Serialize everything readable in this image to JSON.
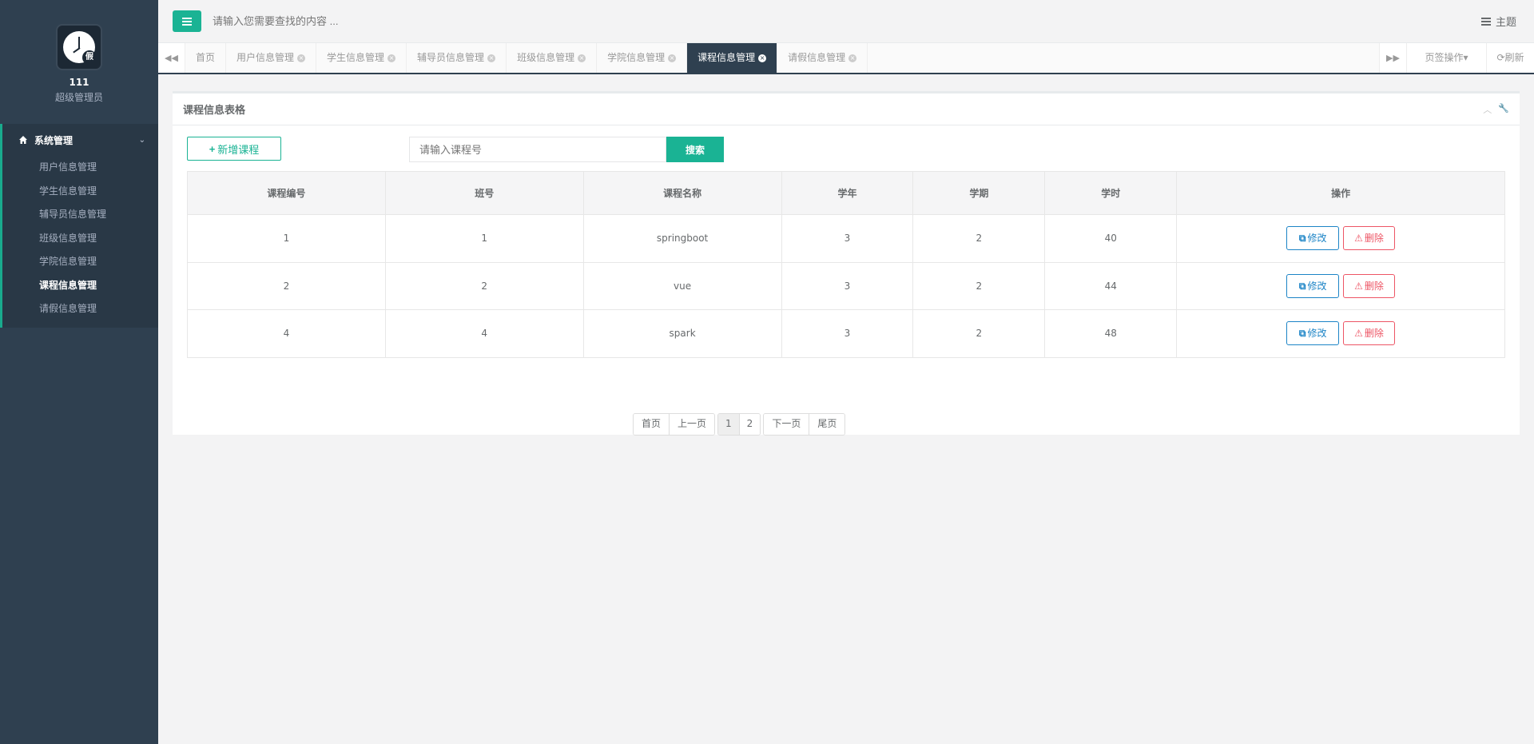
{
  "user": {
    "name": "111",
    "role": "超级管理员",
    "avatar_badge": "假"
  },
  "sidebar": {
    "group_label": "系统管理",
    "items": [
      {
        "label": "用户信息管理"
      },
      {
        "label": "学生信息管理"
      },
      {
        "label": "辅导员信息管理"
      },
      {
        "label": "班级信息管理"
      },
      {
        "label": "学院信息管理"
      },
      {
        "label": "课程信息管理",
        "active": true
      },
      {
        "label": "请假信息管理"
      }
    ]
  },
  "topbar": {
    "search_placeholder": "请输入您需要查找的内容 ...",
    "theme_label": "主题"
  },
  "tabs": {
    "items": [
      {
        "label": "首页"
      },
      {
        "label": "用户信息管理"
      },
      {
        "label": "学生信息管理"
      },
      {
        "label": "辅导员信息管理"
      },
      {
        "label": "班级信息管理"
      },
      {
        "label": "学院信息管理"
      },
      {
        "label": "课程信息管理",
        "active": true
      },
      {
        "label": "请假信息管理"
      }
    ],
    "ops_label": "页签操作",
    "refresh_label": "刷新"
  },
  "panel": {
    "title": "课程信息表格",
    "add_label": "新增课程",
    "search_placeholder": "请输入课程号",
    "search_button": "搜索"
  },
  "table": {
    "headers": [
      "课程编号",
      "班号",
      "课程名称",
      "学年",
      "学期",
      "学时",
      "操作"
    ],
    "rows": [
      {
        "id": "1",
        "class_no": "1",
        "name": "springboot",
        "year": "3",
        "term": "2",
        "hours": "40"
      },
      {
        "id": "2",
        "class_no": "2",
        "name": "vue",
        "year": "3",
        "term": "2",
        "hours": "44"
      },
      {
        "id": "4",
        "class_no": "4",
        "name": "spark",
        "year": "3",
        "term": "2",
        "hours": "48"
      }
    ],
    "edit_label": "修改",
    "delete_label": "删除"
  },
  "pagination": {
    "first": "首页",
    "prev": "上一页",
    "pages": [
      "1",
      "2"
    ],
    "current": "1",
    "next": "下一页",
    "last": "尾页"
  },
  "colors": {
    "accent": "#1ab394",
    "sidebar": "#2f4050",
    "edit": "#1c84c6",
    "delete": "#ed5565"
  }
}
